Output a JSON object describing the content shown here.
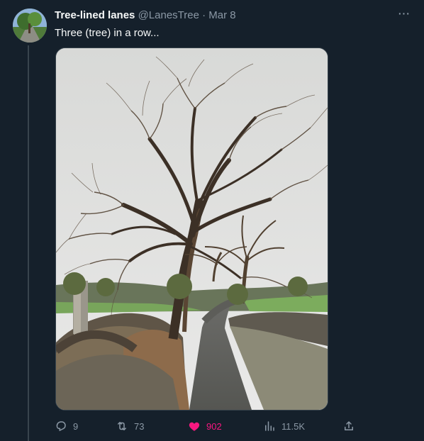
{
  "tweet": {
    "author_name": "Tree-lined lanes",
    "handle": "@LanesTree",
    "separator": "·",
    "date": "Mar 8",
    "text": "Three (tree) in a row...",
    "more_label": "···"
  },
  "actions": {
    "replies": "9",
    "retweets": "73",
    "likes": "902",
    "views": "11.5K"
  },
  "colors": {
    "background": "#15202b",
    "text": "#f7f9f9",
    "muted": "#8b98a5",
    "like": "#f91880"
  },
  "icons": [
    "avatar",
    "more-icon",
    "reply-icon",
    "retweet-icon",
    "heart-icon",
    "views-icon",
    "share-icon"
  ]
}
